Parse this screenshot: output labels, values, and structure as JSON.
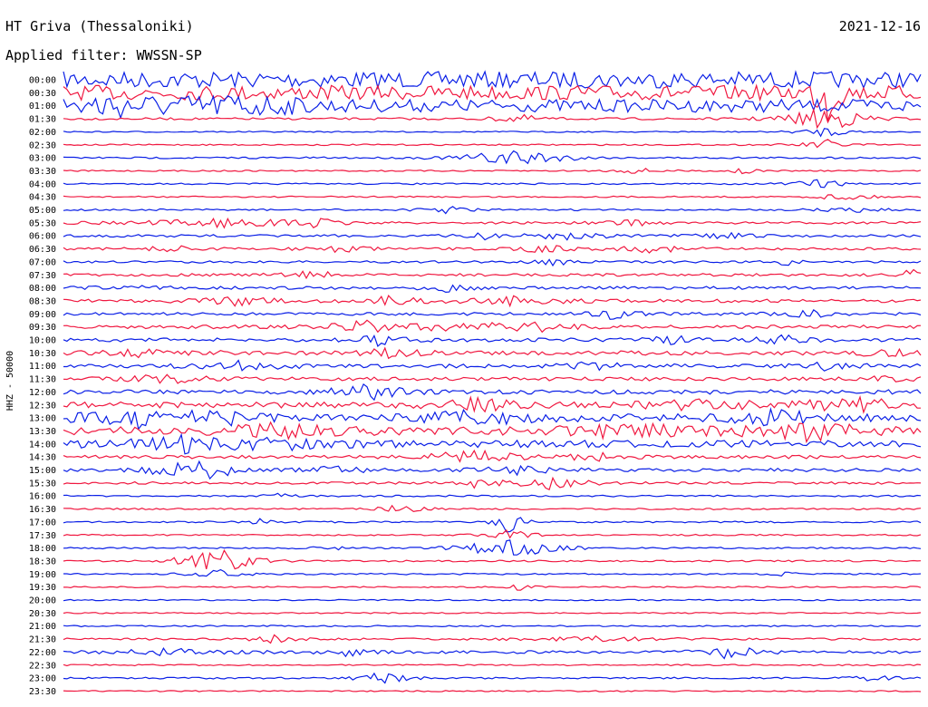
{
  "header": {
    "station": "HT Griva (Thessaloniki)",
    "filter": "Applied filter: WWSSN-SP",
    "date": "2021-12-16"
  },
  "chart_data": {
    "type": "line",
    "title": "HT Griva (Thessaloniki)",
    "subtitle": "Applied filter: WWSSN-SP",
    "date": "2021-12-16",
    "channel_label": "HHZ - 50000",
    "ylabel": "HHZ - 50000",
    "xlabel": "",
    "grid": false,
    "colors": [
      "#0a1fe6",
      "#f01840"
    ],
    "x_range_minutes": [
      0,
      30
    ],
    "rows": [
      {
        "label": "00:00",
        "color_index": 0,
        "noise": 9,
        "events": []
      },
      {
        "label": "00:30",
        "color_index": 1,
        "noise": 8,
        "events": [
          {
            "x": 0.89,
            "amp": 40,
            "dur": 0.01
          }
        ]
      },
      {
        "label": "01:00",
        "color_index": 0,
        "noise": 7,
        "events": [
          {
            "x": 0.05,
            "amp": 10,
            "dur": 0.08
          },
          {
            "x": 0.21,
            "amp": 9,
            "dur": 0.04
          }
        ]
      },
      {
        "label": "01:30",
        "color_index": 1,
        "noise": 1.2,
        "events": [
          {
            "x": 0.89,
            "amp": 16,
            "dur": 0.03
          },
          {
            "x": 0.53,
            "amp": 5,
            "dur": 0.02
          }
        ]
      },
      {
        "label": "02:00",
        "color_index": 0,
        "noise": 0.7,
        "events": [
          {
            "x": 0.89,
            "amp": 6,
            "dur": 0.02
          }
        ]
      },
      {
        "label": "02:30",
        "color_index": 1,
        "noise": 0.8,
        "events": [
          {
            "x": 0.89,
            "amp": 6,
            "dur": 0.02
          }
        ]
      },
      {
        "label": "03:00",
        "color_index": 0,
        "noise": 1.0,
        "events": [
          {
            "x": 0.51,
            "amp": 5,
            "dur": 0.04
          },
          {
            "x": 0.54,
            "amp": 8,
            "dur": 0.03
          }
        ]
      },
      {
        "label": "03:30",
        "color_index": 1,
        "noise": 0.8,
        "events": [
          {
            "x": 0.79,
            "amp": 6,
            "dur": 0.01
          },
          {
            "x": 0.67,
            "amp": 3,
            "dur": 0.02
          }
        ]
      },
      {
        "label": "04:00",
        "color_index": 0,
        "noise": 0.8,
        "events": [
          {
            "x": 0.88,
            "amp": 6,
            "dur": 0.02
          }
        ]
      },
      {
        "label": "04:30",
        "color_index": 1,
        "noise": 0.8,
        "events": [
          {
            "x": 0.91,
            "amp": 5,
            "dur": 0.02
          }
        ]
      },
      {
        "label": "05:00",
        "color_index": 0,
        "noise": 1.0,
        "events": [
          {
            "x": 0.45,
            "amp": 4,
            "dur": 0.02
          },
          {
            "x": 0.92,
            "amp": 4,
            "dur": 0.02
          }
        ]
      },
      {
        "label": "05:30",
        "color_index": 1,
        "noise": 1.3,
        "events": [
          {
            "x": 0.18,
            "amp": 5,
            "dur": 0.06
          },
          {
            "x": 0.29,
            "amp": 6,
            "dur": 0.02
          },
          {
            "x": 0.66,
            "amp": 4,
            "dur": 0.02
          }
        ]
      },
      {
        "label": "06:00",
        "color_index": 0,
        "noise": 1.4,
        "events": [
          {
            "x": 0.49,
            "amp": 4,
            "dur": 0.02
          },
          {
            "x": 0.59,
            "amp": 5,
            "dur": 0.03
          },
          {
            "x": 0.77,
            "amp": 4,
            "dur": 0.02
          }
        ]
      },
      {
        "label": "06:30",
        "color_index": 1,
        "noise": 1.4,
        "events": [
          {
            "x": 0.13,
            "amp": 4,
            "dur": 0.02
          },
          {
            "x": 0.32,
            "amp": 5,
            "dur": 0.02
          },
          {
            "x": 0.56,
            "amp": 5,
            "dur": 0.02
          },
          {
            "x": 0.69,
            "amp": 4,
            "dur": 0.03
          }
        ]
      },
      {
        "label": "07:00",
        "color_index": 0,
        "noise": 1.2,
        "events": [
          {
            "x": 0.57,
            "amp": 4,
            "dur": 0.02
          },
          {
            "x": 0.84,
            "amp": 5,
            "dur": 0.01
          }
        ]
      },
      {
        "label": "07:30",
        "color_index": 1,
        "noise": 1.5,
        "events": [
          {
            "x": 0.29,
            "amp": 6,
            "dur": 0.02
          },
          {
            "x": 0.99,
            "amp": 5,
            "dur": 0.02
          }
        ]
      },
      {
        "label": "08:00",
        "color_index": 0,
        "noise": 1.6,
        "events": [
          {
            "x": 0.07,
            "amp": 5,
            "dur": 0.02
          },
          {
            "x": 0.45,
            "amp": 4,
            "dur": 0.02
          }
        ]
      },
      {
        "label": "08:30",
        "color_index": 1,
        "noise": 1.8,
        "events": [
          {
            "x": 0.2,
            "amp": 5,
            "dur": 0.03
          },
          {
            "x": 0.38,
            "amp": 5,
            "dur": 0.03
          },
          {
            "x": 0.53,
            "amp": 5,
            "dur": 0.04
          }
        ]
      },
      {
        "label": "09:00",
        "color_index": 0,
        "noise": 1.6,
        "events": [
          {
            "x": 0.64,
            "amp": 5,
            "dur": 0.02
          },
          {
            "x": 0.87,
            "amp": 4,
            "dur": 0.02
          }
        ]
      },
      {
        "label": "09:30",
        "color_index": 1,
        "noise": 2.0,
        "events": [
          {
            "x": 0.35,
            "amp": 6,
            "dur": 0.03
          },
          {
            "x": 0.46,
            "amp": 5,
            "dur": 0.04
          },
          {
            "x": 0.55,
            "amp": 5,
            "dur": 0.03
          }
        ]
      },
      {
        "label": "10:00",
        "color_index": 0,
        "noise": 2.0,
        "events": [
          {
            "x": 0.37,
            "amp": 6,
            "dur": 0.02
          },
          {
            "x": 0.71,
            "amp": 5,
            "dur": 0.02
          },
          {
            "x": 0.84,
            "amp": 6,
            "dur": 0.02
          }
        ]
      },
      {
        "label": "10:30",
        "color_index": 1,
        "noise": 2.4,
        "events": [
          {
            "x": 0.11,
            "amp": 6,
            "dur": 0.03
          },
          {
            "x": 0.38,
            "amp": 6,
            "dur": 0.02
          },
          {
            "x": 0.96,
            "amp": 5,
            "dur": 0.02
          }
        ]
      },
      {
        "label": "11:00",
        "color_index": 0,
        "noise": 2.2,
        "events": [
          {
            "x": 0.21,
            "amp": 6,
            "dur": 0.03
          },
          {
            "x": 0.62,
            "amp": 5,
            "dur": 0.02
          },
          {
            "x": 0.89,
            "amp": 4,
            "dur": 0.02
          }
        ]
      },
      {
        "label": "11:30",
        "color_index": 1,
        "noise": 2.0,
        "events": [
          {
            "x": 0.12,
            "amp": 5,
            "dur": 0.03
          },
          {
            "x": 0.96,
            "amp": 4,
            "dur": 0.02
          }
        ]
      },
      {
        "label": "12:00",
        "color_index": 0,
        "noise": 2.4,
        "events": [
          {
            "x": 0.36,
            "amp": 9,
            "dur": 0.03
          }
        ]
      },
      {
        "label": "12:30",
        "color_index": 1,
        "noise": 3.2,
        "events": [
          {
            "x": 0.48,
            "amp": 6,
            "dur": 0.04
          },
          {
            "x": 0.74,
            "amp": 6,
            "dur": 0.04
          },
          {
            "x": 0.92,
            "amp": 7,
            "dur": 0.05
          }
        ]
      },
      {
        "label": "13:00",
        "color_index": 0,
        "noise": 4.5,
        "events": [
          {
            "x": 0.09,
            "amp": 8,
            "dur": 0.04
          },
          {
            "x": 0.17,
            "amp": 9,
            "dur": 0.03
          },
          {
            "x": 0.48,
            "amp": 7,
            "dur": 0.04
          },
          {
            "x": 0.83,
            "amp": 8,
            "dur": 0.03
          }
        ]
      },
      {
        "label": "13:30",
        "color_index": 1,
        "noise": 4.5,
        "events": [
          {
            "x": 0.25,
            "amp": 7,
            "dur": 0.04
          },
          {
            "x": 0.66,
            "amp": 7,
            "dur": 0.05
          },
          {
            "x": 0.87,
            "amp": 8,
            "dur": 0.05
          }
        ]
      },
      {
        "label": "14:00",
        "color_index": 0,
        "noise": 4.0,
        "events": [
          {
            "x": 0.14,
            "amp": 8,
            "dur": 0.04
          },
          {
            "x": 0.26,
            "amp": 7,
            "dur": 0.03
          }
        ]
      },
      {
        "label": "14:30",
        "color_index": 1,
        "noise": 1.8,
        "events": [
          {
            "x": 0.48,
            "amp": 8,
            "dur": 0.04
          },
          {
            "x": 0.62,
            "amp": 5,
            "dur": 0.02
          }
        ]
      },
      {
        "label": "15:00",
        "color_index": 0,
        "noise": 1.8,
        "events": [
          {
            "x": 0.13,
            "amp": 14,
            "dur": 0.02
          },
          {
            "x": 0.17,
            "amp": 13,
            "dur": 0.02
          },
          {
            "x": 0.32,
            "amp": 6,
            "dur": 0.02
          },
          {
            "x": 0.53,
            "amp": 5,
            "dur": 0.03
          }
        ]
      },
      {
        "label": "15:30",
        "color_index": 1,
        "noise": 1.3,
        "events": [
          {
            "x": 0.56,
            "amp": 9,
            "dur": 0.03
          },
          {
            "x": 0.48,
            "amp": 5,
            "dur": 0.01
          }
        ]
      },
      {
        "label": "16:00",
        "color_index": 0,
        "noise": 0.9,
        "events": [
          {
            "x": 0.25,
            "amp": 4,
            "dur": 0.01
          }
        ]
      },
      {
        "label": "16:30",
        "color_index": 1,
        "noise": 0.9,
        "events": [
          {
            "x": 0.39,
            "amp": 6,
            "dur": 0.02
          }
        ]
      },
      {
        "label": "17:00",
        "color_index": 0,
        "noise": 0.9,
        "events": [
          {
            "x": 0.52,
            "amp": 18,
            "dur": 0.01
          },
          {
            "x": 0.23,
            "amp": 4,
            "dur": 0.01
          }
        ]
      },
      {
        "label": "17:30",
        "color_index": 1,
        "noise": 0.8,
        "events": [
          {
            "x": 0.52,
            "amp": 6,
            "dur": 0.02
          }
        ]
      },
      {
        "label": "18:00",
        "color_index": 0,
        "noise": 0.9,
        "events": [
          {
            "x": 0.52,
            "amp": 16,
            "dur": 0.03
          },
          {
            "x": 0.31,
            "amp": 4,
            "dur": 0.01
          }
        ]
      },
      {
        "label": "18:30",
        "color_index": 1,
        "noise": 0.9,
        "events": [
          {
            "x": 0.18,
            "amp": 16,
            "dur": 0.03
          }
        ]
      },
      {
        "label": "19:00",
        "color_index": 0,
        "noise": 0.8,
        "events": [
          {
            "x": 0.18,
            "amp": 6,
            "dur": 0.02
          },
          {
            "x": 0.84,
            "amp": 4,
            "dur": 0.01
          }
        ]
      },
      {
        "label": "19:30",
        "color_index": 1,
        "noise": 0.8,
        "events": [
          {
            "x": 0.53,
            "amp": 4,
            "dur": 0.01
          }
        ]
      },
      {
        "label": "20:00",
        "color_index": 0,
        "noise": 0.7,
        "events": []
      },
      {
        "label": "20:30",
        "color_index": 1,
        "noise": 0.7,
        "events": []
      },
      {
        "label": "21:00",
        "color_index": 0,
        "noise": 0.8,
        "events": []
      },
      {
        "label": "21:30",
        "color_index": 1,
        "noise": 1.1,
        "events": [
          {
            "x": 0.25,
            "amp": 6,
            "dur": 0.02
          },
          {
            "x": 0.62,
            "amp": 3,
            "dur": 0.05
          }
        ]
      },
      {
        "label": "22:00",
        "color_index": 0,
        "noise": 1.6,
        "events": [
          {
            "x": 0.13,
            "amp": 4,
            "dur": 0.04
          },
          {
            "x": 0.33,
            "amp": 4,
            "dur": 0.02
          },
          {
            "x": 0.78,
            "amp": 9,
            "dur": 0.02
          }
        ]
      },
      {
        "label": "22:30",
        "color_index": 1,
        "noise": 0.8,
        "events": []
      },
      {
        "label": "23:00",
        "color_index": 0,
        "noise": 0.9,
        "events": [
          {
            "x": 0.37,
            "amp": 8,
            "dur": 0.02
          },
          {
            "x": 0.94,
            "amp": 4,
            "dur": 0.02
          }
        ]
      },
      {
        "label": "23:30",
        "color_index": 1,
        "noise": 0.7,
        "events": []
      }
    ]
  }
}
